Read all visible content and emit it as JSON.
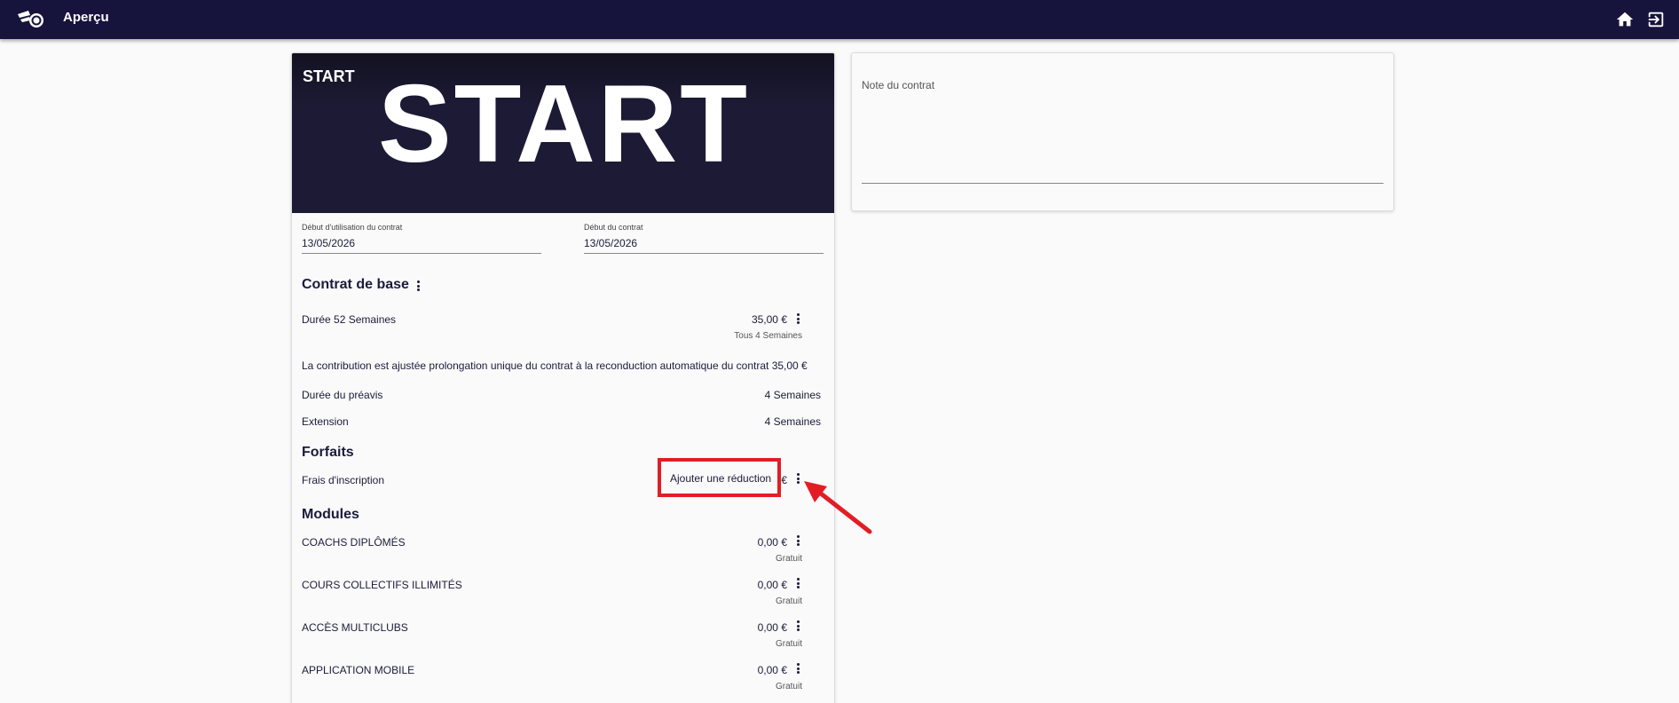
{
  "app": {
    "title": "Aperçu",
    "icons": [
      "logo-icon",
      "home-icon",
      "logout-icon"
    ]
  },
  "contract": {
    "hero_label": "START",
    "hero_image_text": "START",
    "start_use": {
      "label": "Début d'utilisation du contrat",
      "value": "13/05/2026"
    },
    "start": {
      "label": "Début du contrat",
      "value": "13/05/2026"
    },
    "base_title": "Contrat de base",
    "duration": {
      "label": "Durée 52 Semaines",
      "price": "35,00 €",
      "period": "Tous 4 Semaines"
    },
    "contribution_text": "La contribution est ajustée prolongation unique du contrat à la reconduction automatique du contrat 35,00 €",
    "notice": {
      "label": "Durée du préavis",
      "value": "4 Semaines"
    },
    "extension": {
      "label": "Extension",
      "value": "4 Semaines"
    },
    "packages_title": "Forfaits",
    "registration": {
      "label": "Frais d'inscription",
      "currency": "€"
    },
    "popup_action": "Ajouter une réduction",
    "modules_title": "Modules",
    "modules": [
      {
        "name": "COACHS DIPLÔMÉS",
        "price": "0,00 €",
        "note": "Gratuit"
      },
      {
        "name": "COURS COLLECTIFS ILLIMITÉS",
        "price": "0,00 €",
        "note": "Gratuit"
      },
      {
        "name": "ACCÈS MULTICLUBS",
        "price": "0,00 €",
        "note": "Gratuit"
      },
      {
        "name": "APPLICATION MOBILE",
        "price": "0,00 €",
        "note": "Gratuit"
      }
    ]
  },
  "note": {
    "label": "Note du contrat",
    "value": ""
  },
  "colors": {
    "topbar": "#16133d",
    "hero": "#1d1a35",
    "highlight": "#e21d24",
    "text": "#1c1b3a"
  }
}
